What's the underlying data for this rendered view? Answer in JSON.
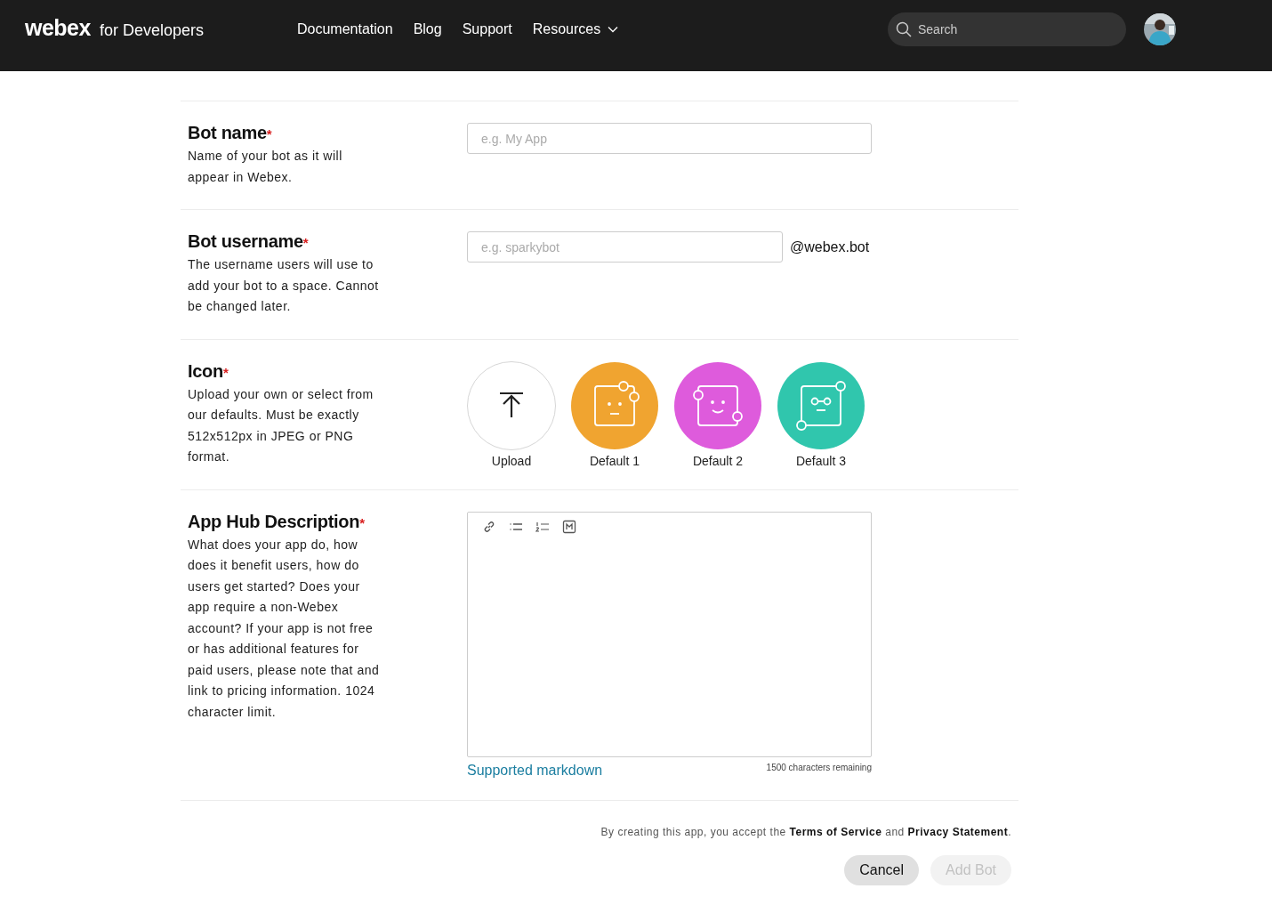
{
  "header": {
    "logo": "webex",
    "logo_suffix": "for Developers",
    "nav": [
      {
        "label": "Documentation",
        "dropdown": false
      },
      {
        "label": "Blog",
        "dropdown": false
      },
      {
        "label": "Support",
        "dropdown": false
      },
      {
        "label": "Resources",
        "dropdown": true
      }
    ],
    "search": {
      "placeholder": "Search"
    }
  },
  "form": {
    "rows": [
      {
        "kind": "text",
        "label": "Bot name",
        "required_mark": "*",
        "help": "Name of your bot as it will appear in Webex.",
        "placeholder": "e.g. My App"
      },
      {
        "kind": "username",
        "label": "Bot username",
        "required_mark": "*",
        "help": "The username users will use to add your bot to a space. Cannot be changed later.",
        "placeholder": "e.g. sparkybot",
        "suffix": "@webex.bot"
      },
      {
        "kind": "icons",
        "label": "Icon",
        "required_mark": "*",
        "help": "Upload your own or select from our defaults. Must be exactly 512x512px in JPEG or PNG format.",
        "options": [
          {
            "kind": "upload",
            "label": "Upload"
          },
          {
            "kind": "dots",
            "label": "Default 1",
            "color": "#f0a430"
          },
          {
            "kind": "smile",
            "label": "Default 2",
            "color": "#de5bdc"
          },
          {
            "kind": "glasses",
            "label": "Default 3",
            "color": "#30c6ad"
          }
        ]
      },
      {
        "kind": "editor",
        "label": "App Hub Description",
        "required_mark": "*",
        "help": "What does your app do, how does it benefit users, how do users get started? Does your app require a non-Webex account? If your app is not free or has additional features for paid users, please note that and link to pricing information. 1024 character limit.",
        "link": "Supported markdown",
        "counter": "1500 characters remaining"
      }
    ]
  },
  "consent": [
    {
      "kind": "text",
      "text": "By creating this app, you accept the "
    },
    {
      "kind": "link",
      "text": "Terms of Service"
    },
    {
      "kind": "text",
      "text": " and "
    },
    {
      "kind": "link",
      "text": "Privacy Statement"
    },
    {
      "kind": "text",
      "text": "."
    }
  ],
  "buttons": [
    {
      "label": "Cancel",
      "disabled": false
    },
    {
      "label": "Add Bot",
      "disabled": true
    }
  ]
}
